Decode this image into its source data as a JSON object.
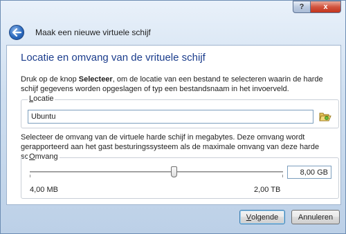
{
  "window": {
    "help_button": "?",
    "close_button": "x",
    "title": "Maak een nieuwe virtuele schijf"
  },
  "page": {
    "heading": "Locatie en omvang van de vrituele schijf",
    "location_description": {
      "prefix": "Druk op de knop ",
      "button_ref": "Selecteer",
      "suffix": ", om de locatie van een bestand te selecteren waarin de harde schijf gegevens worden opgeslagen of typ een bestandsnaam in het invoerveld."
    },
    "location_group": {
      "label_mnemonic": "L",
      "label_rest": "ocatie",
      "value": "Ubuntu"
    },
    "size_description": "Selecteer de omvang van de virtuele harde schijf in megabytes. Deze omvang wordt gerapporteerd aan het gast besturingssysteem als de maximale omvang van deze harde schijf.",
    "size_group": {
      "label_mnemonic": "O",
      "label_rest": "mvang",
      "value": "8,00 GB",
      "min_label": "4,00 MB",
      "max_label": "2,00 TB",
      "slider_fraction": 0.57
    }
  },
  "footer": {
    "next_mnemonic": "V",
    "next_rest": "olgende",
    "cancel_label": "Annuleren"
  },
  "colors": {
    "heading": "#1a3c8c",
    "accent": "#2c6bbf"
  },
  "icons": {
    "back": "back-arrow-icon",
    "folder": "open-folder-icon"
  }
}
